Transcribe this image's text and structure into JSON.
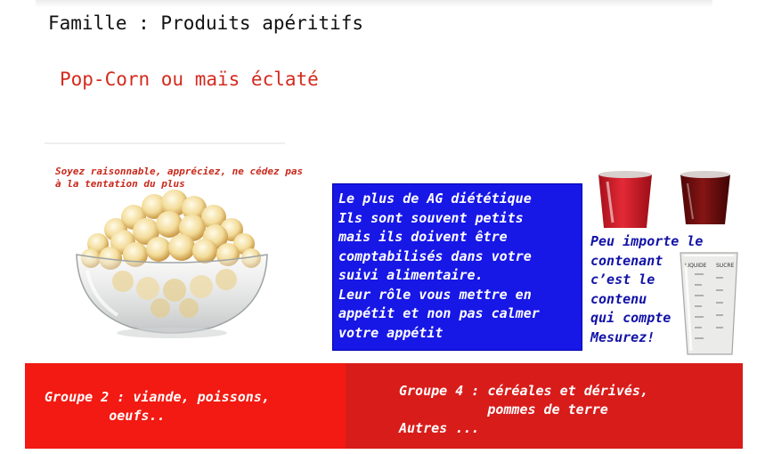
{
  "header": {
    "family": "Famille : Produits apéritifs",
    "product": "Pop-Corn ou maïs éclaté"
  },
  "advice": "Soyez raisonnable, appréciez, ne cédez pas à la tentation du plus",
  "info_box": {
    "lines": [
      "Le plus de AG diététique",
      "Ils sont souvent petits",
      "mais ils doivent être",
      "comptabilisés dans votre",
      "suivi alimentaire.",
      "Leur rôle vous mettre en",
      "appétit et non pas calmer",
      "votre appétit"
    ]
  },
  "container_note": {
    "lines": [
      "Peu importe le",
      "contenant",
      "c’est le",
      "contenu",
      "qui compte",
      "Mesurez!"
    ]
  },
  "measuring_cup_labels": [
    "LIQUIDE",
    "SUCRE"
  ],
  "groups": {
    "group2": "Groupe 2 : viande, poissons,\n        oeufs..",
    "group4": "Groupe 4 : céréales et dérivés,\n           pommes de terre",
    "others": "Autres ..."
  },
  "colors": {
    "title_red": "#d42a1e",
    "blue_box": "#1717e6",
    "band_left": "#f21a12",
    "band_right": "#d81c1a",
    "note_blue": "#1212a8"
  }
}
